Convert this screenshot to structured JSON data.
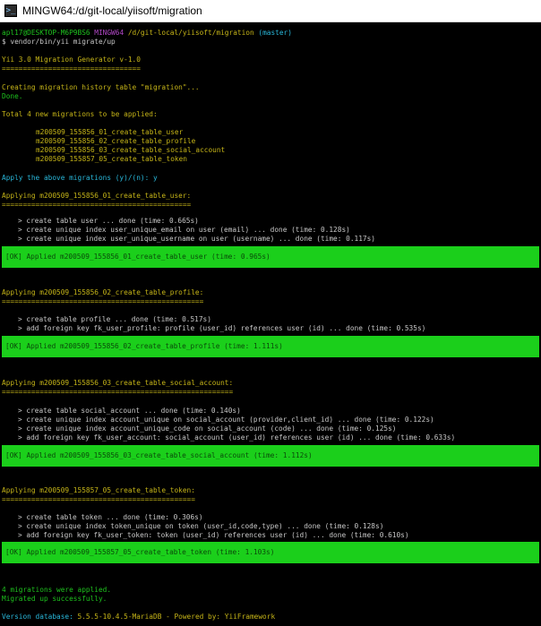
{
  "window": {
    "title": "MINGW64:/d/git-local/yiisoft/migration"
  },
  "prompt": {
    "user_host": "apl17@DESKTOP-M6P9BS6",
    "shell": "MINGW64",
    "path": "/d/git-local/yiisoft/migration",
    "branch": "(master)",
    "command": "$ vendor/bin/yii migrate/up"
  },
  "header": {
    "title": "Yii 3.0 Migration Generator v-1.0",
    "rule": "================================="
  },
  "history": {
    "creating": "Creating migration history table \"migration\"...",
    "done": "Done."
  },
  "total": "Total 4 new migrations to be applied:",
  "pending": [
    "m200509_155856_01_create_table_user",
    "m200509_155856_02_create_table_profile",
    "m200509_155856_03_create_table_social_account",
    "m200509_155857_05_create_table_token"
  ],
  "confirm": "Apply the above migrations (y)/(n): y",
  "migrations": [
    {
      "heading": "Applying m200509_155856_01_create_table_user:",
      "rule": "=============================================",
      "steps": [
        "> create table user ... done (time: 0.665s)",
        "> create unique index user_unique_email on user (email) ... done (time: 0.128s)",
        "> create unique index user_unique_username on user (username) ... done (time: 0.117s)"
      ],
      "result": "[OK] Applied m200509_155856_01_create_table_user (time: 0.965s)"
    },
    {
      "heading": "Applying m200509_155856_02_create_table_profile:",
      "rule": "================================================",
      "steps": [
        "> create table profile ... done (time: 0.517s)",
        "> add foreign key fk_user_profile: profile (user_id) references user (id) ... done (time: 0.535s)"
      ],
      "result": "[OK] Applied m200509_155856_02_create_table_profile (time: 1.111s)"
    },
    {
      "heading": "Applying m200509_155856_03_create_table_social_account:",
      "rule": "=======================================================",
      "steps": [
        "> create table social_account ... done (time: 0.140s)",
        "> create unique index account_unique on social_account (provider,client_id) ... done (time: 0.122s)",
        "> create unique index account_unique_code on social_account (code) ... done (time: 0.125s)",
        "> add foreign key fk_user_account: social_account (user_id) references user (id) ... done (time: 0.633s)"
      ],
      "result": "[OK] Applied m200509_155856_03_create_table_social_account (time: 1.112s)"
    },
    {
      "heading": "Applying m200509_155857_05_create_table_token:",
      "rule": "==============================================",
      "steps": [
        "> create table token ... done (time: 0.306s)",
        "> create unique index token_unique on token (user_id,code,type) ... done (time: 0.128s)",
        "> add foreign key fk_user_token: token (user_id) references user (id) ... done (time: 0.610s)"
      ],
      "result": "[OK] Applied m200509_155857_05_create_table_token (time: 1.103s)"
    }
  ],
  "summary": {
    "applied": "4 migrations were applied.",
    "migrated": "Migrated up successfully."
  },
  "footer": {
    "version_label": "Version database: ",
    "version": "5.5.5-10.4.5-MariaDB",
    "powered": " - Powered by: YiiFramework"
  },
  "colors": {
    "background": "#000000",
    "ok_bar": "#1bcf1b",
    "prompt_user": "#1ec21e",
    "prompt_shell": "#b148c6",
    "prompt_path": "#c6b518",
    "prompt_branch": "#29b8db"
  }
}
